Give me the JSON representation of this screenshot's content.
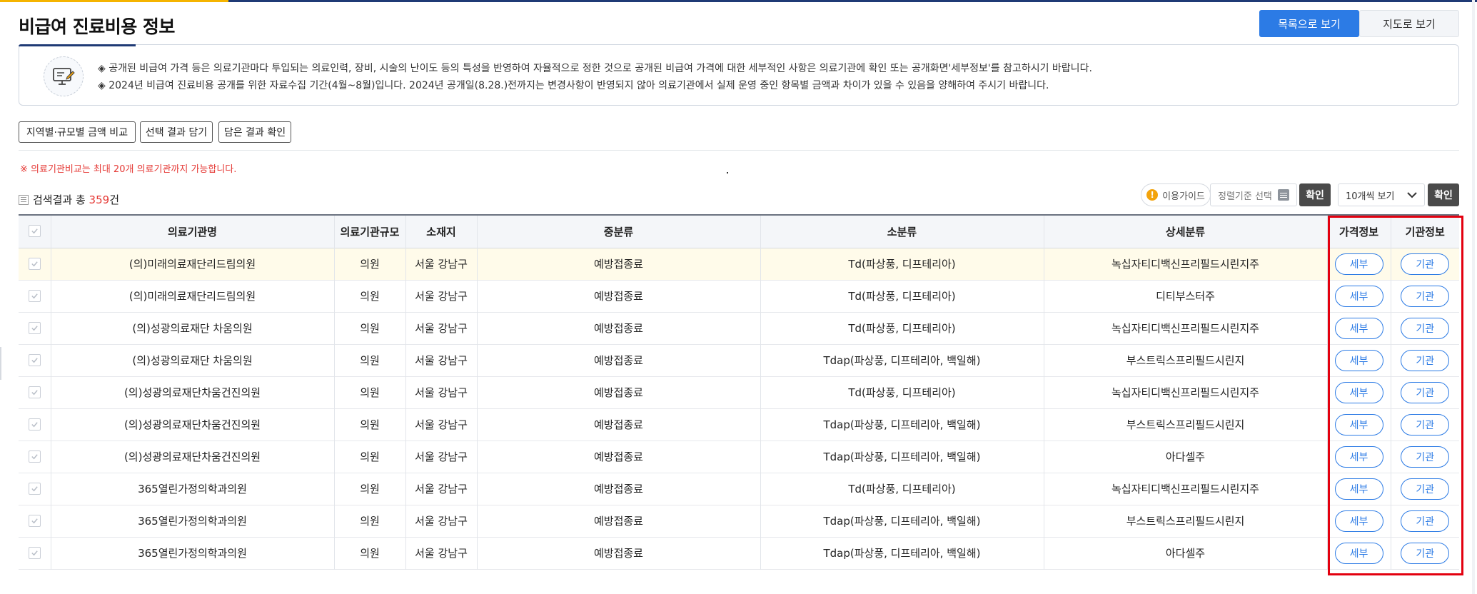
{
  "page": {
    "title": "비급여 진료비용 정보",
    "view_list": "목록으로 보기",
    "view_map": "지도로 보기"
  },
  "notice": {
    "line1": "◈ 공개된 비급여 가격 등은 의료기관마다 투입되는 의료인력, 장비, 시술의 난이도 등의 특성을 반영하여 자율적으로 정한 것으로 공개된 비급여 가격에 대한 세부적인 사항은 의료기관에 확인 또는 공개화면'세부정보'를 참고하시기 바랍니다.",
    "line2": "◈ 2024년 비급여 진료비용 공개를 위한 자료수집 기간(4월~8월)입니다. 2024년 공개일(8.28.)전까지는 변경사항이 반영되지 않아 의료기관에서 실제 운영 중인 항목별 금액과 차이가 있을 수 있음을 양해하여 주시기 바랍니다."
  },
  "actions": {
    "compare": "지역별·규모별 금액 비교",
    "add": "선택 결과 담기",
    "check": "담은 결과 확인"
  },
  "warning": "※ 의료기관비교는 최대 20개 의료기관까지 가능합니다.",
  "result": {
    "prefix": "검색결과 총 ",
    "count": "359",
    "suffix": "건"
  },
  "toolbar": {
    "guide": "이용가이드",
    "sort_placeholder": "정렬기준 선택",
    "confirm": "확인",
    "per_page": "10개씩 보기",
    "confirm2": "확인"
  },
  "table": {
    "headers": [
      "의료기관명",
      "의료기관규모",
      "소재지",
      "중분류",
      "소분류",
      "상세분류",
      "가격정보",
      "기관정보"
    ],
    "detail_label": "세부",
    "org_label": "기관",
    "rows": [
      {
        "name": "(의)미래의료재단리드림의원",
        "scale": "의원",
        "loc": "서울 강남구",
        "mid": "예방접종료",
        "sub": "Td(파상풍, 디프테리아)",
        "detail": "녹십자티디백신프리필드시린지주"
      },
      {
        "name": "(의)미래의료재단리드림의원",
        "scale": "의원",
        "loc": "서울 강남구",
        "mid": "예방접종료",
        "sub": "Td(파상풍, 디프테리아)",
        "detail": "디티부스터주"
      },
      {
        "name": "(의)성광의료재단 차움의원",
        "scale": "의원",
        "loc": "서울 강남구",
        "mid": "예방접종료",
        "sub": "Td(파상풍, 디프테리아)",
        "detail": "녹십자티디백신프리필드시린지주"
      },
      {
        "name": "(의)성광의료재단 차움의원",
        "scale": "의원",
        "loc": "서울 강남구",
        "mid": "예방접종료",
        "sub": "Tdap(파상풍, 디프테리아, 백일해)",
        "detail": "부스트릭스프리필드시린지"
      },
      {
        "name": "(의)성광의료재단차움건진의원",
        "scale": "의원",
        "loc": "서울 강남구",
        "mid": "예방접종료",
        "sub": "Td(파상풍, 디프테리아)",
        "detail": "녹십자티디백신프리필드시린지주"
      },
      {
        "name": "(의)성광의료재단차움건진의원",
        "scale": "의원",
        "loc": "서울 강남구",
        "mid": "예방접종료",
        "sub": "Tdap(파상풍, 디프테리아, 백일해)",
        "detail": "부스트릭스프리필드시린지"
      },
      {
        "name": "(의)성광의료재단차움건진의원",
        "scale": "의원",
        "loc": "서울 강남구",
        "mid": "예방접종료",
        "sub": "Tdap(파상풍, 디프테리아, 백일해)",
        "detail": "아다셀주"
      },
      {
        "name": "365열린가정의학과의원",
        "scale": "의원",
        "loc": "서울 강남구",
        "mid": "예방접종료",
        "sub": "Td(파상풍, 디프테리아)",
        "detail": "녹십자티디백신프리필드시린지주"
      },
      {
        "name": "365열린가정의학과의원",
        "scale": "의원",
        "loc": "서울 강남구",
        "mid": "예방접종료",
        "sub": "Tdap(파상풍, 디프테리아, 백일해)",
        "detail": "부스트릭스프리필드시린지"
      },
      {
        "name": "365열린가정의학과의원",
        "scale": "의원",
        "loc": "서울 강남구",
        "mid": "예방접종료",
        "sub": "Tdap(파상풍, 디프테리아, 백일해)",
        "detail": "아다셀주"
      }
    ]
  },
  "colors": {
    "primary": "#2c7be5",
    "highlight_box": "#e3000f",
    "warning_text": "#e53935",
    "row_highlight": "#fffbea"
  },
  "icons": {
    "notice": "monitor-edit-icon",
    "guide": "exclamation-icon",
    "sort": "list-icon",
    "per_page": "chevron-down-icon",
    "checkbox": "check-icon"
  }
}
